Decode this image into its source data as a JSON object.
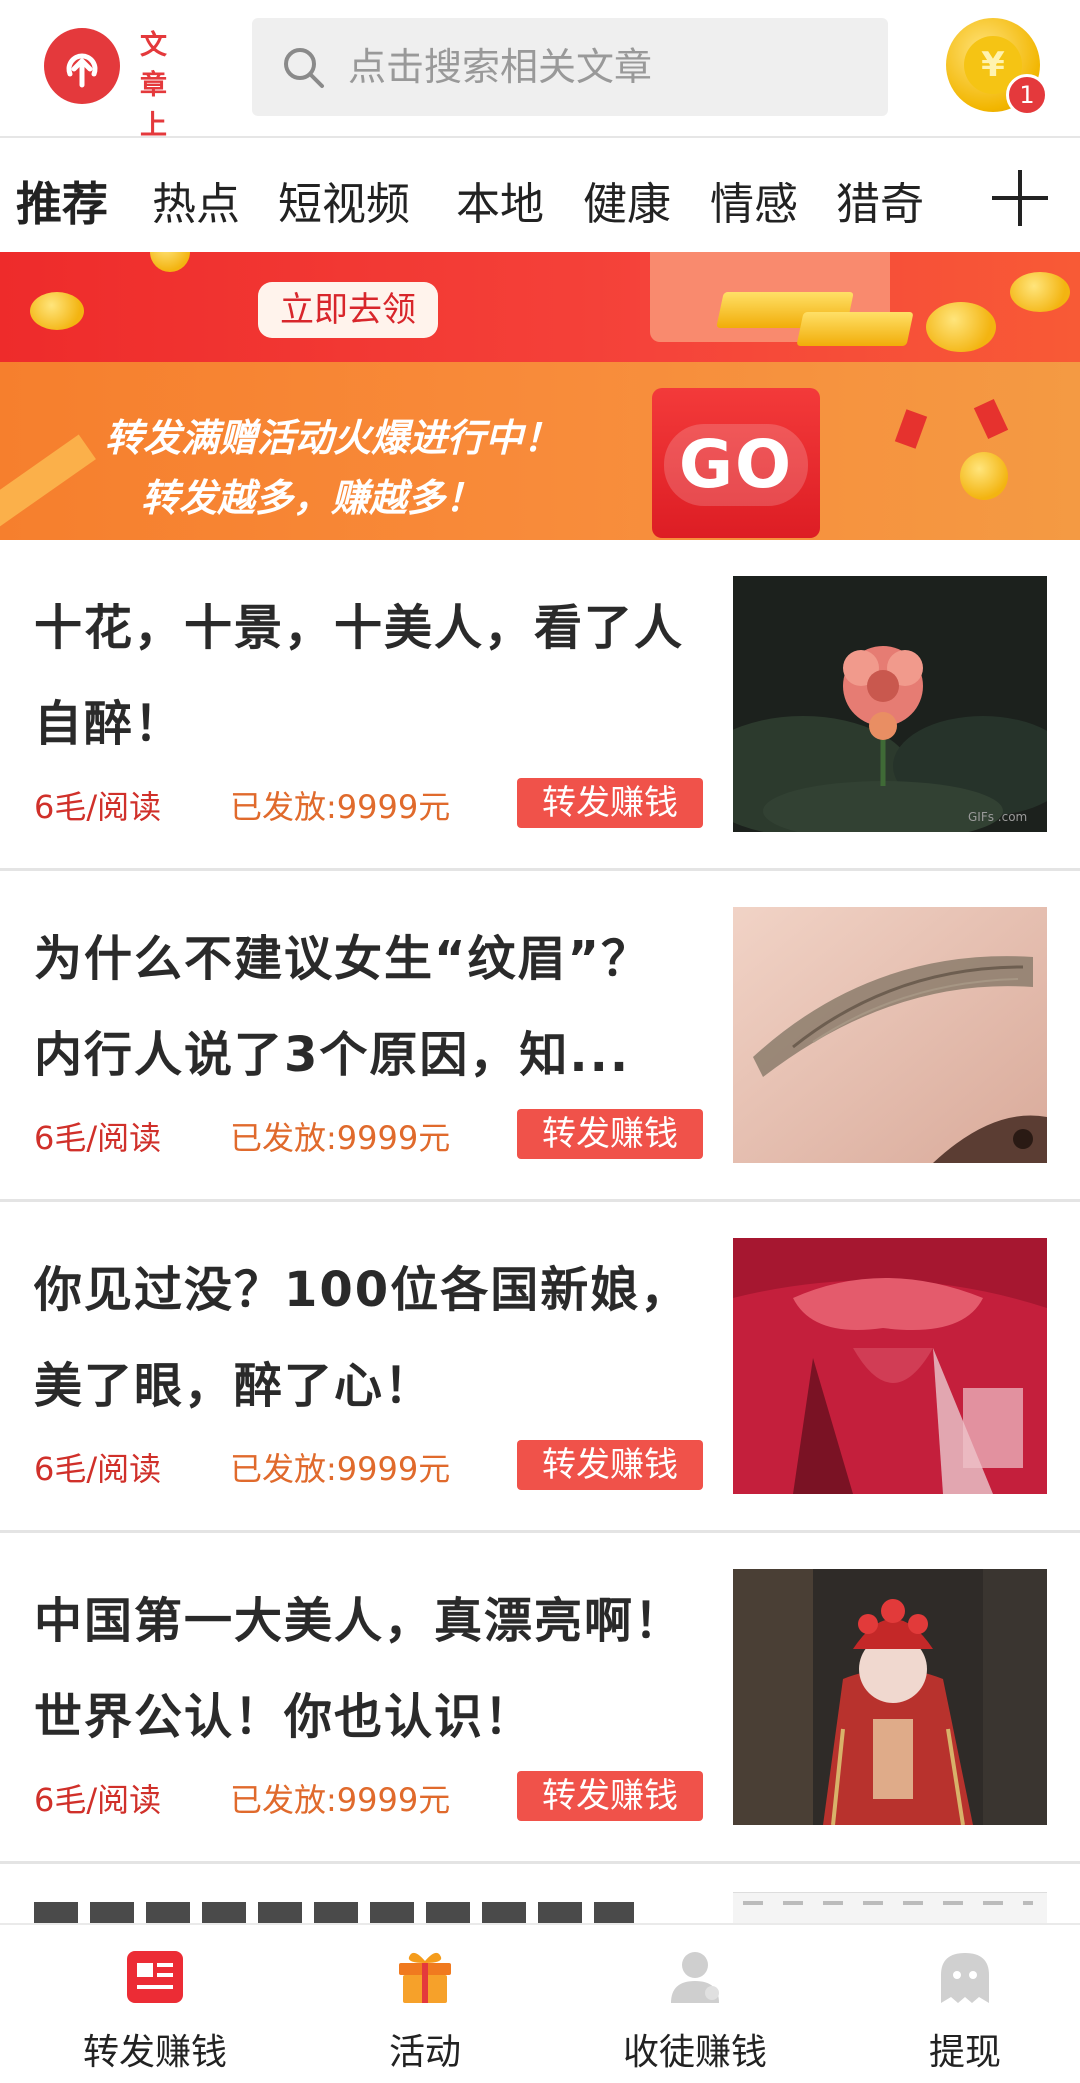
{
  "header": {
    "upload_label": "文章 上传",
    "search_placeholder": "点击搜索相关文章",
    "coin_badge": "1",
    "coin_glyph": "¥"
  },
  "tabs": {
    "items": [
      "推荐",
      "热点",
      "短视频",
      "本地",
      "健康",
      "情感",
      "猎奇"
    ],
    "active_index": 0
  },
  "banners": {
    "claim_button": "立即去领",
    "promo_line1": "转发满赠活动火爆进行中！",
    "promo_line2": "转发越多，赚越多！",
    "promo_graphic_text": "GO"
  },
  "articles": [
    {
      "title": "十花，十景，十美人，看了人自醉！",
      "rate": "6毛/阅读",
      "paid": "已发放:9999元",
      "action": "转发赚钱",
      "thumb_caption": "GIFs .com"
    },
    {
      "title": "为什么不建议女生“纹眉”？内行人说了3个原因，知...",
      "rate": "6毛/阅读",
      "paid": "已发放:9999元",
      "action": "转发赚钱"
    },
    {
      "title": "你见过没？100位各国新娘，美了眼，醉了心！",
      "rate": "6毛/阅读",
      "paid": "已发放:9999元",
      "action": "转发赚钱"
    },
    {
      "title": "中国第一大美人，真漂亮啊！世界公认！你也认识！",
      "rate": "6毛/阅读",
      "paid": "已发放:9999元",
      "action": "转发赚钱"
    }
  ],
  "bottom_nav": [
    {
      "label": "转发赚钱",
      "icon": "news-icon",
      "active": true
    },
    {
      "label": "活动",
      "icon": "gift-icon",
      "active": false
    },
    {
      "label": "收徒赚钱",
      "icon": "user-icon",
      "active": false
    },
    {
      "label": "提现",
      "icon": "ghost-icon",
      "active": false
    }
  ],
  "colors": {
    "brand_red": "#e4393c",
    "share_button": "#f0524a",
    "rate_text": "#d0302a",
    "paid_text": "#e06a2c",
    "coin_gold": "#f2b600"
  }
}
